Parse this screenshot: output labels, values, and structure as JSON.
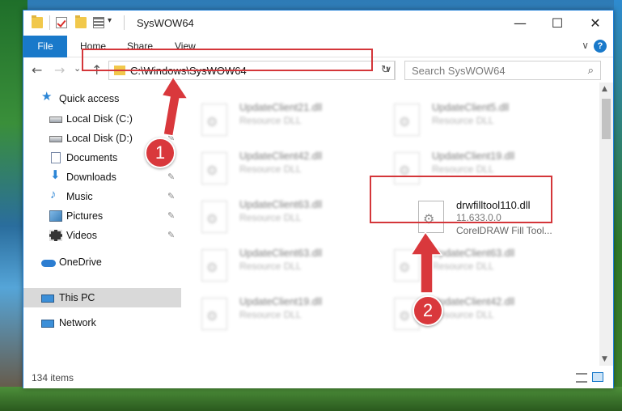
{
  "window": {
    "title": "SysWOW64",
    "minimize": "—",
    "maximize": "☐",
    "close": "✕"
  },
  "ribbon": {
    "tabs": [
      "File",
      "Home",
      "Share",
      "View"
    ],
    "collapse_icon": "chevron-down-icon",
    "help": "?"
  },
  "navigation": {
    "back": "←",
    "forward": "→",
    "recent": "⌄",
    "up": "↑",
    "address": "C:\\Windows\\SysWOW64",
    "dropdown": "∨",
    "refresh": "↻",
    "search_placeholder": "Search SysWOW64",
    "search_icon": "⌕"
  },
  "sidebar": {
    "items": [
      {
        "label": "Quick access",
        "icon": "star-icon",
        "pinned": false
      },
      {
        "label": "Local Disk (C:)",
        "icon": "drive-icon",
        "pinned": true
      },
      {
        "label": "Local Disk (D:)",
        "icon": "drive-icon",
        "pinned": true
      },
      {
        "label": "Documents",
        "icon": "document-icon",
        "pinned": true
      },
      {
        "label": "Downloads",
        "icon": "download-icon",
        "pinned": true
      },
      {
        "label": "Music",
        "icon": "music-icon",
        "pinned": true
      },
      {
        "label": "Pictures",
        "icon": "pictures-icon",
        "pinned": true
      },
      {
        "label": "Videos",
        "icon": "videos-icon",
        "pinned": true
      },
      {
        "label": "OneDrive",
        "icon": "cloud-icon",
        "pinned": false
      },
      {
        "label": "This PC",
        "icon": "computer-icon",
        "pinned": false,
        "selected": true
      },
      {
        "label": "Network",
        "icon": "network-icon",
        "pinned": false
      }
    ],
    "pin_glyph": "📌"
  },
  "files": {
    "left_column": [
      {
        "name": "UpdateClient21.dll",
        "type": "Resource DLL"
      },
      {
        "name": "UpdateClient42.dll",
        "type": "Resource DLL"
      },
      {
        "name": "UpdateClient63.dll",
        "type": "Resource DLL"
      },
      {
        "name": "UpdateClient63.dll",
        "type": "Resource DLL"
      },
      {
        "name": "UpdateClient19.dll",
        "type": "Resource DLL"
      }
    ],
    "right_column": [
      {
        "name": "UpdateClient5.dll",
        "type": "Resource DLL"
      },
      {
        "name": "UpdateClient19.dll",
        "type": "Resource DLL"
      },
      {
        "name": "drwfilltool110.dll",
        "type": "11.633.0.0",
        "desc": "CorelDRAW Fill Tool..."
      },
      {
        "name": "UpdateClient63.dll",
        "type": "Resource DLL"
      },
      {
        "name": "UpdateClient42.dll",
        "type": "Resource DLL"
      }
    ]
  },
  "status": {
    "item_count": "134 items"
  },
  "markers": {
    "step1": "1",
    "step2": "2"
  },
  "colors": {
    "accent": "#1979ca",
    "highlight": "#d4363a",
    "marker": "#d9383c"
  }
}
